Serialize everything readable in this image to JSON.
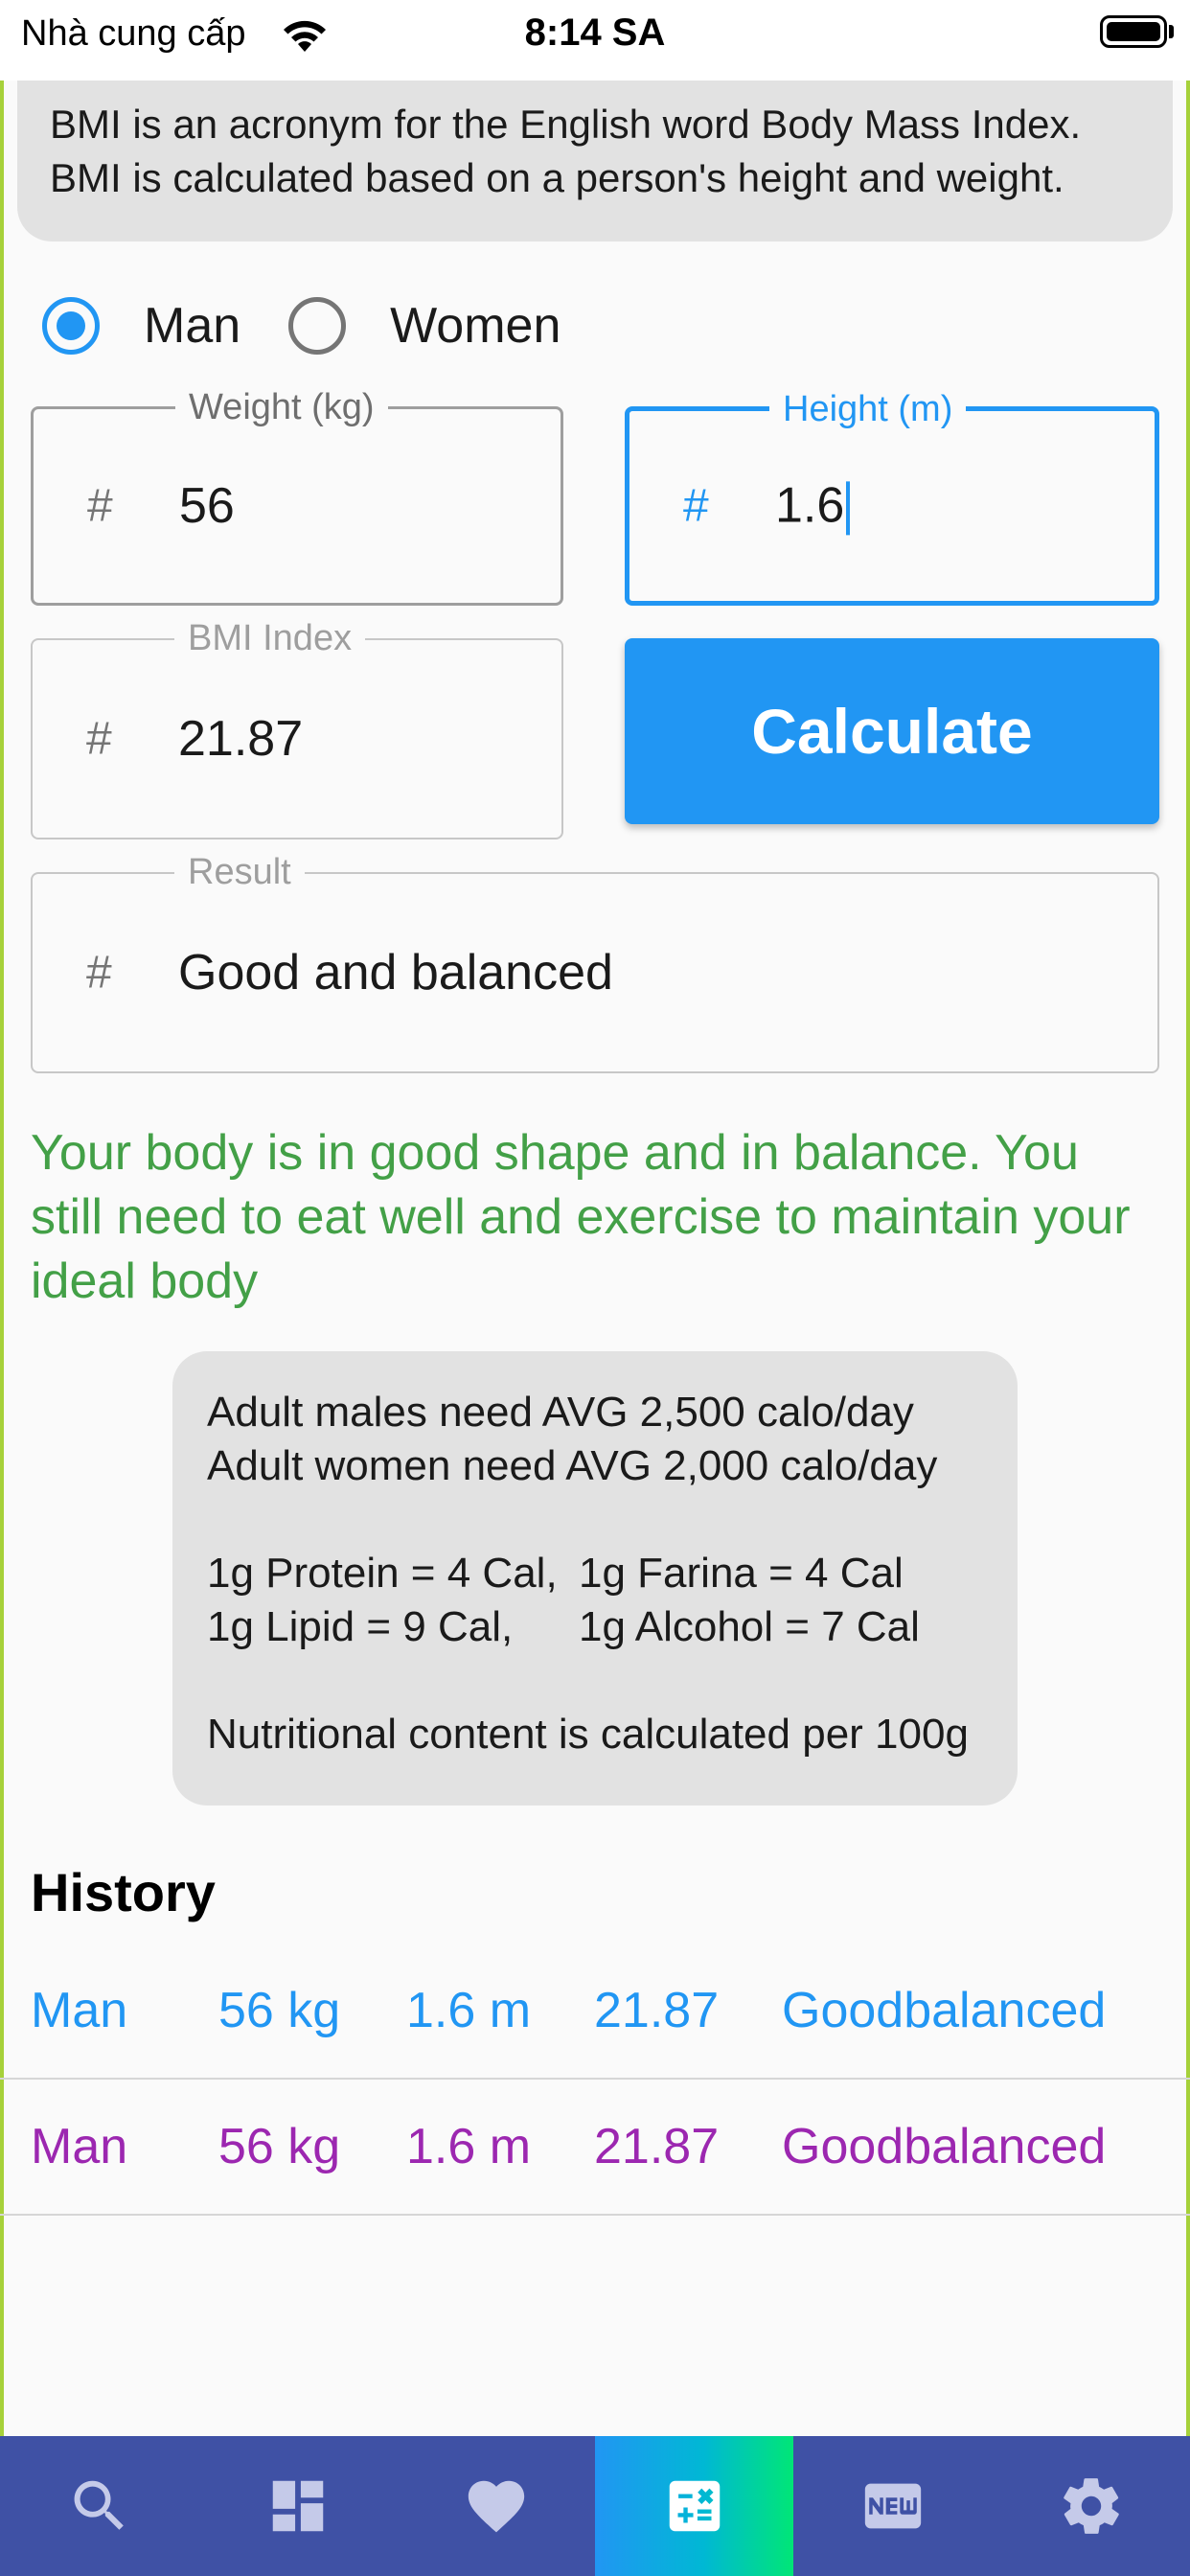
{
  "status_bar": {
    "carrier": "Nhà cung cấp",
    "time": "8:14 SA"
  },
  "info_top": {
    "line1": "BMI is an acronym for the English word Body Mass Index.",
    "line2": "BMI is calculated based on a person's height and weight."
  },
  "gender": {
    "options": [
      "Man",
      "Women"
    ],
    "selected": "Man"
  },
  "weight": {
    "label": "Weight (kg)",
    "value": "56"
  },
  "height": {
    "label": "Height (m)",
    "value": "1.6"
  },
  "bmi": {
    "label": "BMI Index",
    "value": "21.87"
  },
  "calculate_label": "Calculate",
  "result": {
    "label": "Result",
    "value": "Good and balanced"
  },
  "advice": "Your body is in good shape and in balance. You still need to eat well and exercise to maintain your ideal body",
  "nutrition": {
    "line1": "Adult males need AVG 2,500 calo/day",
    "line2": "Adult women need AVG 2,000 calo/day",
    "protein": "1g Protein = 4 Cal,",
    "farina": "1g Farina = 4 Cal",
    "lipid": "1g Lipid = 9 Cal,",
    "alcohol": "1g Alcohol = 7 Cal",
    "note": "Nutritional content is calculated per 100g"
  },
  "history": {
    "title": "History",
    "rows": [
      {
        "gender": "Man",
        "weight": "56 kg",
        "height": "1.6 m",
        "bmi": "21.87",
        "result": "Goodbalanced",
        "color": "#2196f3"
      },
      {
        "gender": "Man",
        "weight": "56 kg",
        "height": "1.6 m",
        "bmi": "21.87",
        "result": "Goodbalanced",
        "color": "#9c27b0"
      }
    ]
  },
  "colors": {
    "accent": "#2196f3",
    "advice": "#43a047",
    "nav_bg": "#3f51a5"
  },
  "bottom_nav": {
    "items": [
      "search-icon",
      "dashboard-icon",
      "heart-icon",
      "calculator-icon",
      "new-badge-icon",
      "gear-icon"
    ],
    "active": "calculator-icon"
  }
}
